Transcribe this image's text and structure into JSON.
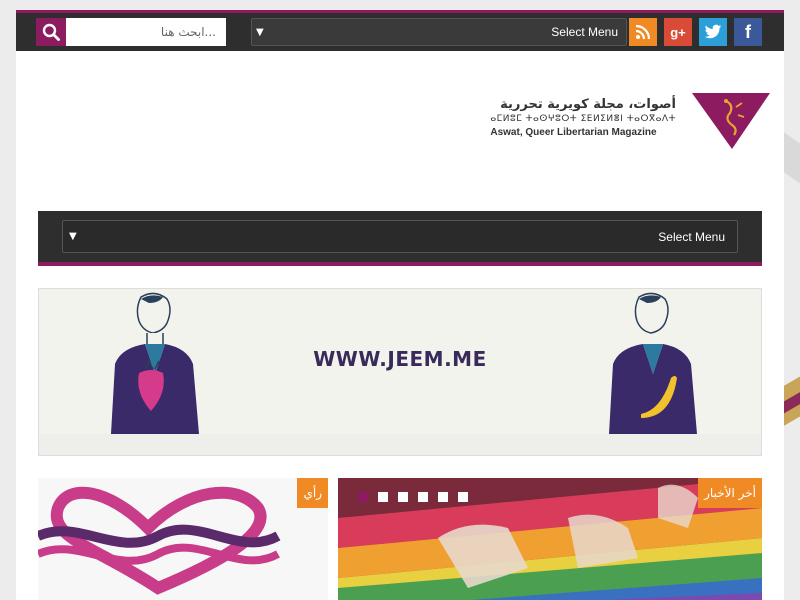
{
  "topbar": {
    "search_placeholder": "ابحث هنا...",
    "select_menu": "Select Menu",
    "social": [
      {
        "name": "rss-icon"
      },
      {
        "name": "google-plus-icon",
        "glyph": "g+"
      },
      {
        "name": "twitter-icon"
      },
      {
        "name": "facebook-icon",
        "glyph": "f"
      }
    ]
  },
  "header": {
    "logo_arabic": "أصوات، مجلة كويرية تحررية",
    "logo_tifinagh": "ⴰⵎⵍⵓⵎ ⵜⴰⵙⵖⵓⵔⵜ ⵉⴹⵍⵉⵍⴻⵏ ⵜⴰⵔⴳⴰⴷⵜ",
    "logo_english": "Aswat, Queer Libertarian Magazine"
  },
  "nav": {
    "select_menu": "Select Menu"
  },
  "banner": {
    "text": "WWW.JEEM.ME"
  },
  "cards": {
    "left_category": "رأي",
    "right_category": "أخر الأخبار",
    "slider_dots": 6,
    "active_dot": 0
  },
  "colors": {
    "accent": "#8c1c5f",
    "orange": "#f08a24",
    "dark": "#2e2e2e"
  }
}
